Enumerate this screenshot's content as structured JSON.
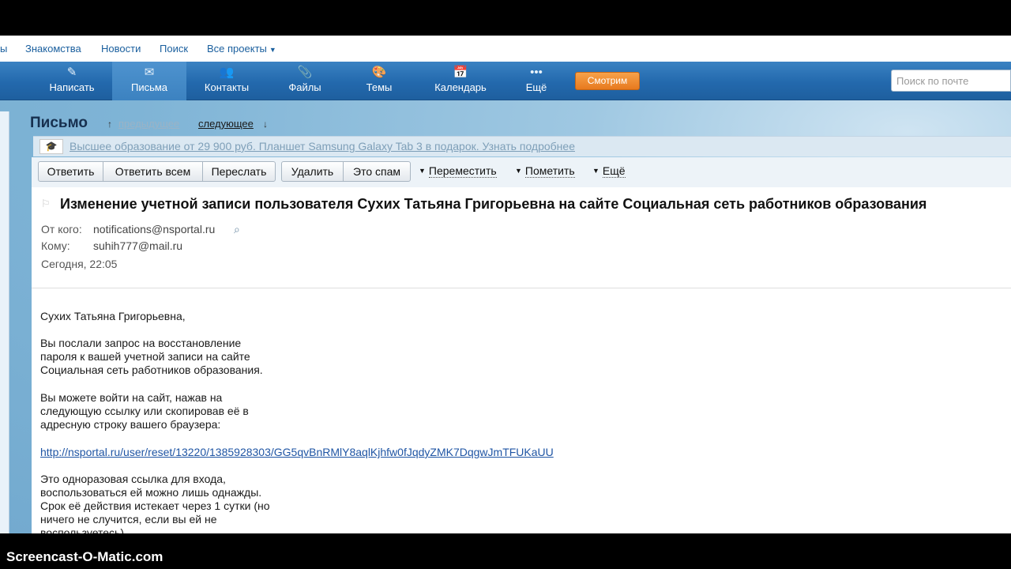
{
  "portal_nav": {
    "items": [
      "ы",
      "Знакомства",
      "Новости",
      "Поиск",
      "Все проекты"
    ]
  },
  "main_nav": {
    "items": [
      {
        "label": "Написать",
        "icon": "pencil-icon"
      },
      {
        "label": "Письма",
        "icon": "envelope-icon"
      },
      {
        "label": "Контакты",
        "icon": "contacts-icon"
      },
      {
        "label": "Файлы",
        "icon": "paperclip-icon"
      },
      {
        "label": "Темы",
        "icon": "palette-icon"
      },
      {
        "label": "Календарь",
        "icon": "calendar-icon"
      },
      {
        "label": "Ещё",
        "icon": "more-dots-icon"
      }
    ],
    "watch_button": "Смотрим",
    "search_placeholder": "Поиск по почте"
  },
  "page": {
    "title": "Письмо",
    "prev_label": "предыдущее",
    "next_label": "следующее"
  },
  "ad": {
    "text": "Высшее образование от 29 900 руб. Планшет Samsung Galaxy Tab 3 в подарок. Узнать подробнее"
  },
  "toolbar": {
    "reply": "Ответить",
    "reply_all": "Ответить всем",
    "forward": "Переслать",
    "delete": "Удалить",
    "spam": "Это спам",
    "move": "Переместить",
    "mark": "Пометить",
    "more": "Ещё"
  },
  "message": {
    "subject": "Изменение учетной записи пользователя Сухих Татьяна Григорьевна на сайте Социальная сеть работников образования",
    "from_label": "От кого:",
    "from": "notifications@nsportal.ru",
    "to_label": "Кому:",
    "to": "suhih777@mail.ru",
    "date": "Сегодня, 22:05",
    "greeting": "Сухих Татьяна Григорьевна,",
    "p1": [
      "Вы послали запрос на восстановление",
      "пароля к вашей учетной записи на сайте",
      "Социальная сеть работников образования."
    ],
    "p2": [
      "Вы можете войти на сайт, нажав на",
      "следующую ссылку или скопировав её в",
      "адресную строку вашего браузера:"
    ],
    "link": "http://nsportal.ru/user/reset/13220/1385928303/GG5qvBnRMlY8aqlKjhfw0fJqdyZMK7DqgwJmTFUKaUU",
    "p3": [
      "Это одноразовая ссылка для входа,",
      "воспользоваться ей можно лишь однажды.",
      "Срок её действия истекает через 1 сутки (но",
      "ничего не случится, если вы ей не",
      "воспользуетесь)."
    ]
  },
  "watermark": "Screencast-O-Matic.com"
}
